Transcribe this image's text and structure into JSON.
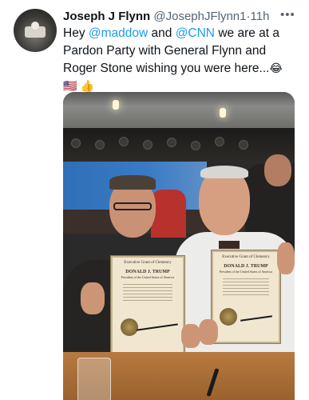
{
  "tweet": {
    "author": {
      "name": "Joseph J Flynn",
      "handle": "@JosephJFlynn1",
      "separator": "·",
      "time": "11h"
    },
    "more_label": "•••",
    "text": {
      "t1": "Hey ",
      "m1": "@maddow",
      "t2": " and ",
      "m2": "@CNN",
      "t3": " we are at a Pardon Party with General Flynn and Roger Stone wishing you were here...",
      "emojis": "😂 🇺🇸 👍",
      "emoji2": "💥"
    },
    "photo": {
      "certificate_left": {
        "title": "Executive Grant of Clemency",
        "name": "DONALD J. TRUMP",
        "subtitle": "President of the United States of America"
      },
      "certificate_right": {
        "title": "Executive Grant of Clemency",
        "name": "DONALD J. TRUMP",
        "subtitle": "President of the United States of America"
      }
    }
  }
}
